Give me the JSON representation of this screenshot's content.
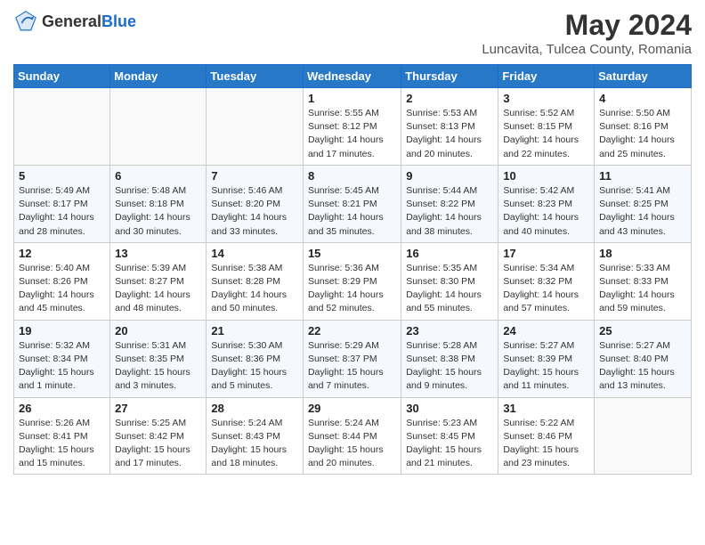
{
  "header": {
    "logo_general": "General",
    "logo_blue": "Blue",
    "month_title": "May 2024",
    "location": "Luncavita, Tulcea County, Romania"
  },
  "weekdays": [
    "Sunday",
    "Monday",
    "Tuesday",
    "Wednesday",
    "Thursday",
    "Friday",
    "Saturday"
  ],
  "weeks": [
    [
      {
        "day": "",
        "info": ""
      },
      {
        "day": "",
        "info": ""
      },
      {
        "day": "",
        "info": ""
      },
      {
        "day": "1",
        "info": "Sunrise: 5:55 AM\nSunset: 8:12 PM\nDaylight: 14 hours and 17 minutes."
      },
      {
        "day": "2",
        "info": "Sunrise: 5:53 AM\nSunset: 8:13 PM\nDaylight: 14 hours and 20 minutes."
      },
      {
        "day": "3",
        "info": "Sunrise: 5:52 AM\nSunset: 8:15 PM\nDaylight: 14 hours and 22 minutes."
      },
      {
        "day": "4",
        "info": "Sunrise: 5:50 AM\nSunset: 8:16 PM\nDaylight: 14 hours and 25 minutes."
      }
    ],
    [
      {
        "day": "5",
        "info": "Sunrise: 5:49 AM\nSunset: 8:17 PM\nDaylight: 14 hours and 28 minutes."
      },
      {
        "day": "6",
        "info": "Sunrise: 5:48 AM\nSunset: 8:18 PM\nDaylight: 14 hours and 30 minutes."
      },
      {
        "day": "7",
        "info": "Sunrise: 5:46 AM\nSunset: 8:20 PM\nDaylight: 14 hours and 33 minutes."
      },
      {
        "day": "8",
        "info": "Sunrise: 5:45 AM\nSunset: 8:21 PM\nDaylight: 14 hours and 35 minutes."
      },
      {
        "day": "9",
        "info": "Sunrise: 5:44 AM\nSunset: 8:22 PM\nDaylight: 14 hours and 38 minutes."
      },
      {
        "day": "10",
        "info": "Sunrise: 5:42 AM\nSunset: 8:23 PM\nDaylight: 14 hours and 40 minutes."
      },
      {
        "day": "11",
        "info": "Sunrise: 5:41 AM\nSunset: 8:25 PM\nDaylight: 14 hours and 43 minutes."
      }
    ],
    [
      {
        "day": "12",
        "info": "Sunrise: 5:40 AM\nSunset: 8:26 PM\nDaylight: 14 hours and 45 minutes."
      },
      {
        "day": "13",
        "info": "Sunrise: 5:39 AM\nSunset: 8:27 PM\nDaylight: 14 hours and 48 minutes."
      },
      {
        "day": "14",
        "info": "Sunrise: 5:38 AM\nSunset: 8:28 PM\nDaylight: 14 hours and 50 minutes."
      },
      {
        "day": "15",
        "info": "Sunrise: 5:36 AM\nSunset: 8:29 PM\nDaylight: 14 hours and 52 minutes."
      },
      {
        "day": "16",
        "info": "Sunrise: 5:35 AM\nSunset: 8:30 PM\nDaylight: 14 hours and 55 minutes."
      },
      {
        "day": "17",
        "info": "Sunrise: 5:34 AM\nSunset: 8:32 PM\nDaylight: 14 hours and 57 minutes."
      },
      {
        "day": "18",
        "info": "Sunrise: 5:33 AM\nSunset: 8:33 PM\nDaylight: 14 hours and 59 minutes."
      }
    ],
    [
      {
        "day": "19",
        "info": "Sunrise: 5:32 AM\nSunset: 8:34 PM\nDaylight: 15 hours and 1 minute."
      },
      {
        "day": "20",
        "info": "Sunrise: 5:31 AM\nSunset: 8:35 PM\nDaylight: 15 hours and 3 minutes."
      },
      {
        "day": "21",
        "info": "Sunrise: 5:30 AM\nSunset: 8:36 PM\nDaylight: 15 hours and 5 minutes."
      },
      {
        "day": "22",
        "info": "Sunrise: 5:29 AM\nSunset: 8:37 PM\nDaylight: 15 hours and 7 minutes."
      },
      {
        "day": "23",
        "info": "Sunrise: 5:28 AM\nSunset: 8:38 PM\nDaylight: 15 hours and 9 minutes."
      },
      {
        "day": "24",
        "info": "Sunrise: 5:27 AM\nSunset: 8:39 PM\nDaylight: 15 hours and 11 minutes."
      },
      {
        "day": "25",
        "info": "Sunrise: 5:27 AM\nSunset: 8:40 PM\nDaylight: 15 hours and 13 minutes."
      }
    ],
    [
      {
        "day": "26",
        "info": "Sunrise: 5:26 AM\nSunset: 8:41 PM\nDaylight: 15 hours and 15 minutes."
      },
      {
        "day": "27",
        "info": "Sunrise: 5:25 AM\nSunset: 8:42 PM\nDaylight: 15 hours and 17 minutes."
      },
      {
        "day": "28",
        "info": "Sunrise: 5:24 AM\nSunset: 8:43 PM\nDaylight: 15 hours and 18 minutes."
      },
      {
        "day": "29",
        "info": "Sunrise: 5:24 AM\nSunset: 8:44 PM\nDaylight: 15 hours and 20 minutes."
      },
      {
        "day": "30",
        "info": "Sunrise: 5:23 AM\nSunset: 8:45 PM\nDaylight: 15 hours and 21 minutes."
      },
      {
        "day": "31",
        "info": "Sunrise: 5:22 AM\nSunset: 8:46 PM\nDaylight: 15 hours and 23 minutes."
      },
      {
        "day": "",
        "info": ""
      }
    ]
  ]
}
